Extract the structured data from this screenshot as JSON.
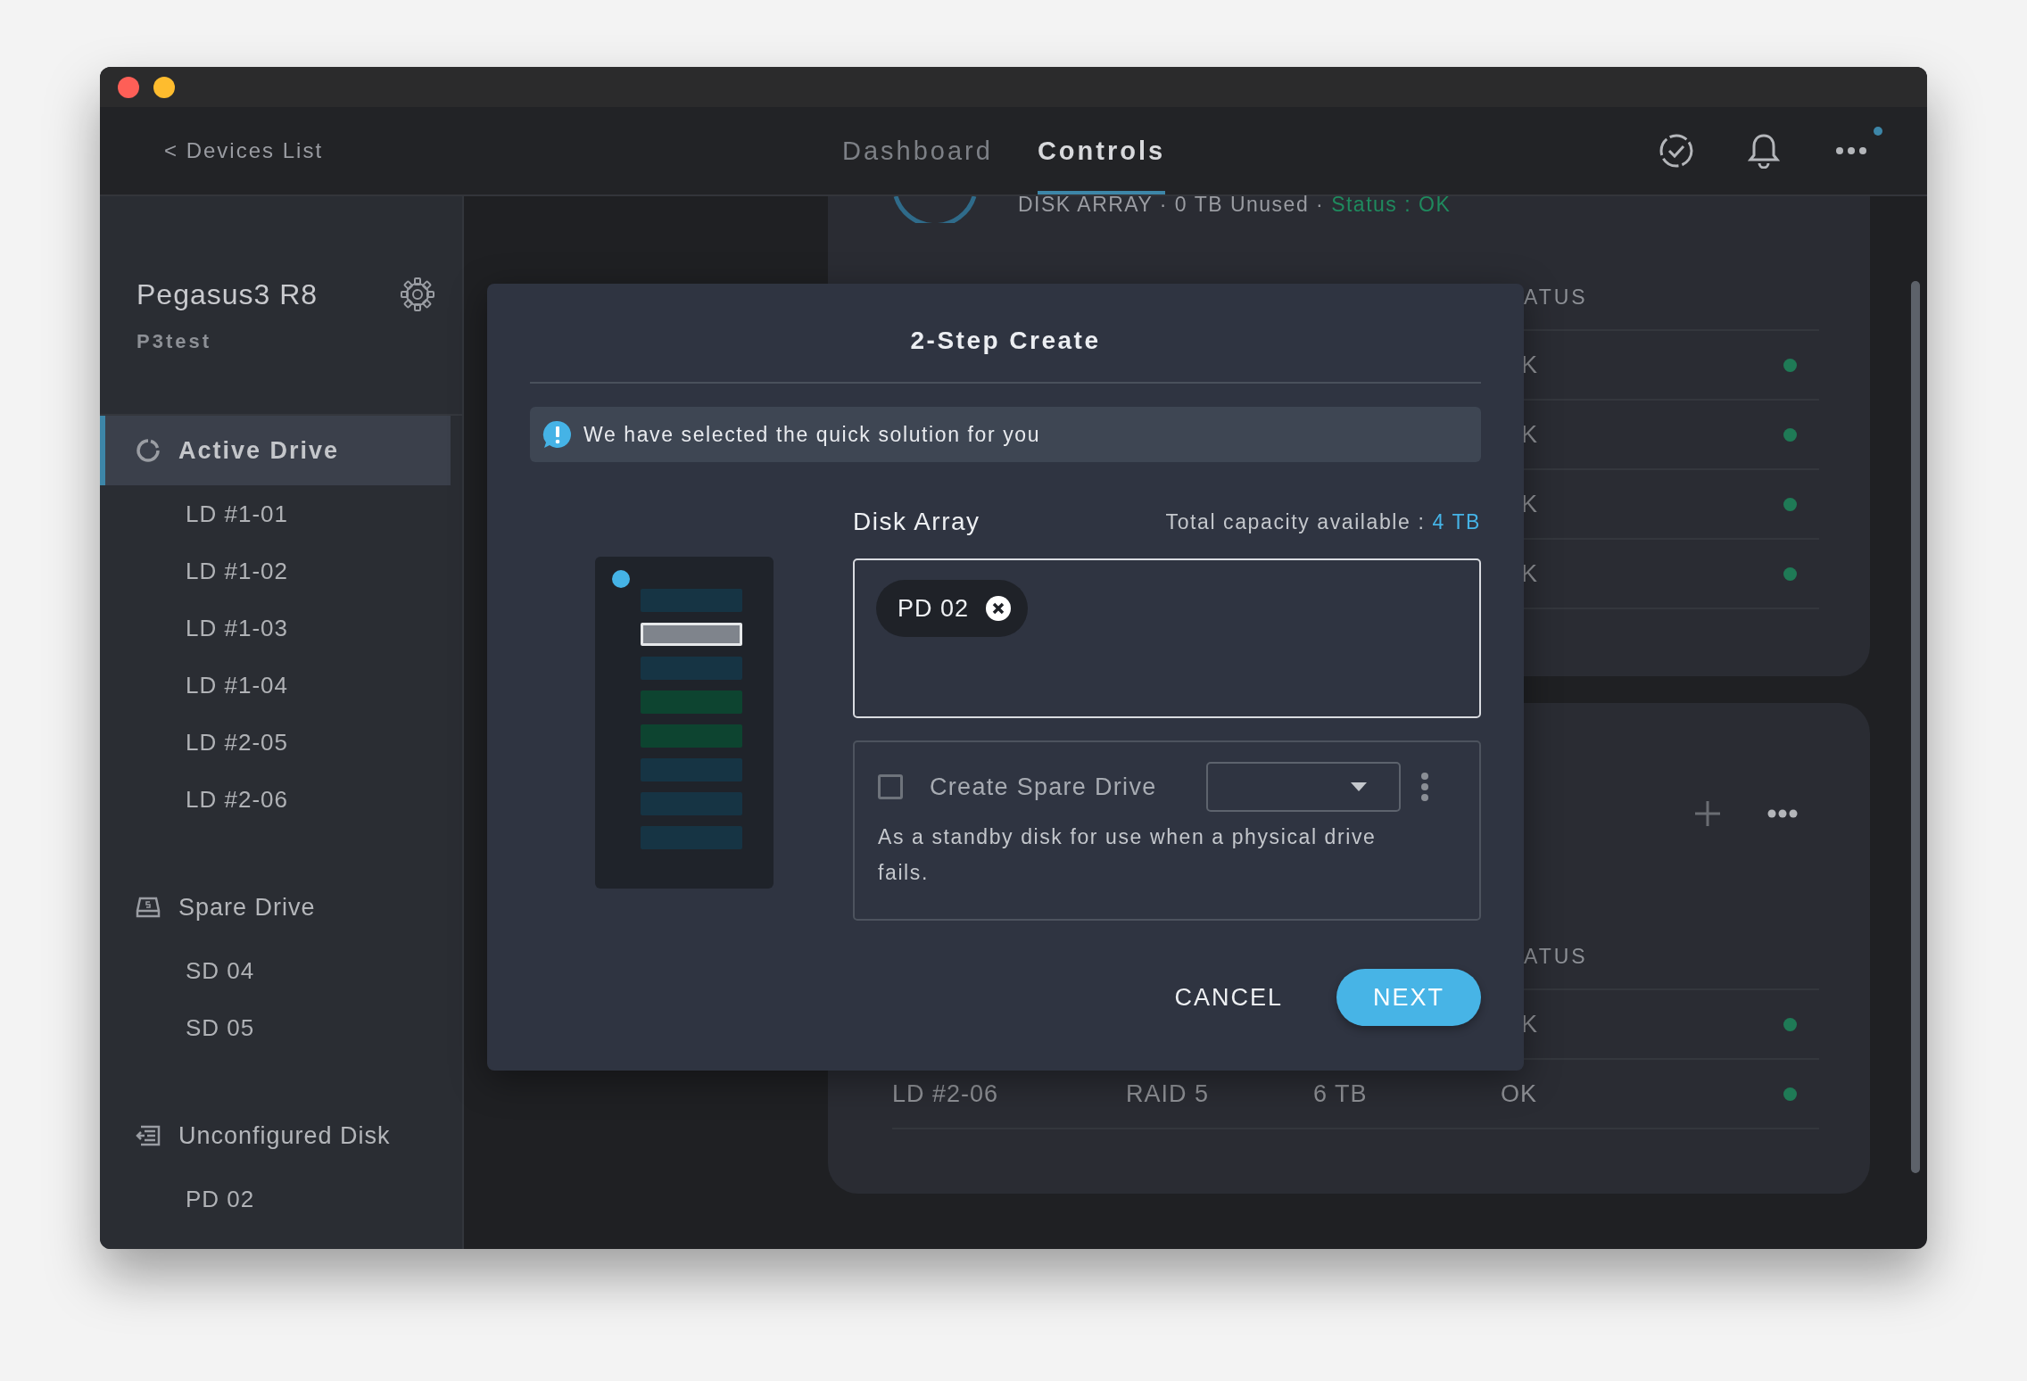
{
  "header": {
    "back_link": "< Devices List",
    "tabs": [
      {
        "label": "Dashboard",
        "selected": false
      },
      {
        "label": "Controls",
        "selected": true
      }
    ],
    "has_notification": true
  },
  "sidebar": {
    "device_name": "Pegasus3 R8",
    "device_subtitle": "P3test",
    "sections": [
      {
        "kind": "active",
        "label": "Active Drive",
        "selected": true,
        "items": [
          "LD #1-01",
          "LD #1-02",
          "LD #1-03",
          "LD #1-04",
          "LD #2-05",
          "LD #2-06"
        ]
      },
      {
        "kind": "spare",
        "label": "Spare Drive",
        "selected": false,
        "items": [
          "SD 04",
          "SD 05"
        ]
      },
      {
        "kind": "unconfigured",
        "label": "Unconfigured Disk",
        "selected": false,
        "items": [
          "PD 02"
        ]
      }
    ]
  },
  "cards": [
    {
      "kind": "summary",
      "summary": "DISK ARRAY · 0 TB Unused · ",
      "status": "Status : OK",
      "column_header": "ATUS",
      "rows": [
        {
          "cells": [
            "",
            "",
            "",
            "K"
          ]
        },
        {
          "cells": [
            "",
            "",
            "",
            "K"
          ]
        },
        {
          "cells": [
            "",
            "",
            "",
            "K"
          ]
        },
        {
          "cells": [
            "",
            "",
            "",
            "K"
          ]
        }
      ]
    },
    {
      "kind": "actions",
      "column_header": "ATUS",
      "rows": [
        {
          "cells": [
            "",
            "",
            "",
            "K"
          ]
        },
        {
          "cells": [
            "LD #2-06",
            "RAID 5",
            "6 TB",
            "OK"
          ]
        }
      ]
    }
  ],
  "dialog": {
    "title": "2-Step Create",
    "info": "We have selected the quick solution for you",
    "enclosure": {
      "slots": [
        {
          "kind": "free"
        },
        {
          "kind": "selected"
        },
        {
          "kind": "free"
        },
        {
          "kind": "used"
        },
        {
          "kind": "used"
        },
        {
          "kind": "free"
        },
        {
          "kind": "free"
        },
        {
          "kind": "free"
        }
      ]
    },
    "disk_array": {
      "label": "Disk Array",
      "capacity_label": "Total capacity available : ",
      "capacity_value": "4 TB",
      "chips": [
        {
          "label": "PD 02"
        }
      ]
    },
    "spare": {
      "checked": false,
      "label": "Create Spare Drive",
      "description": "As a standby disk for use when a physical drive fails."
    },
    "buttons": [
      {
        "label": "CANCEL",
        "kind": "text"
      },
      {
        "label": "NEXT",
        "kind": "primary"
      }
    ]
  }
}
